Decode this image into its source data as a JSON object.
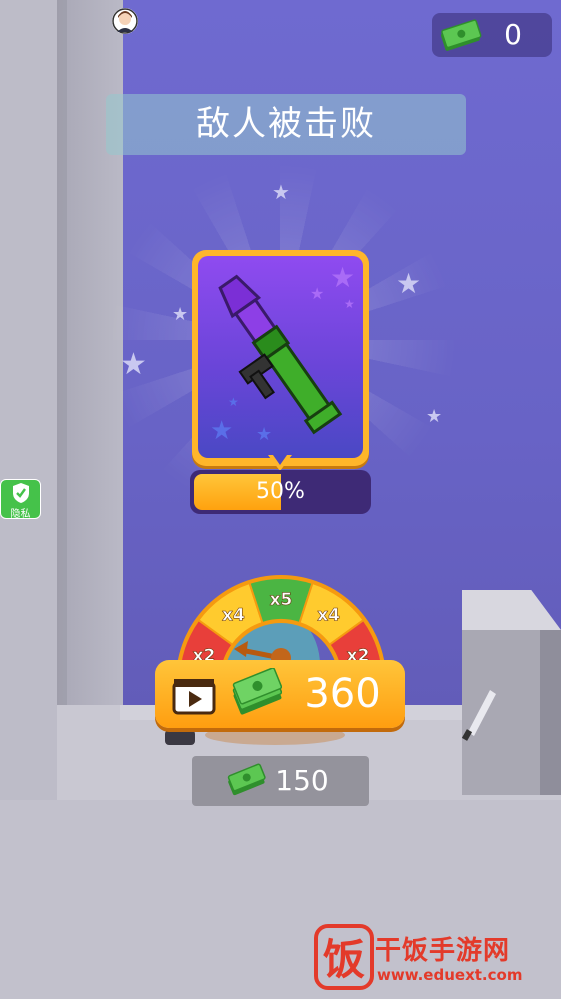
{
  "hud": {
    "money_count": "0",
    "cash_icon": "cash-stack-icon",
    "avatar_icon": "user-avatar-icon"
  },
  "title": {
    "text": "敌人被击败"
  },
  "reward_card": {
    "item_icon": "rocket-launcher-icon",
    "progress_fraction": 0.5,
    "progress_label": "50%"
  },
  "privacy": {
    "label": "隐私",
    "icon": "shield-check-icon"
  },
  "multiplier_wheel": {
    "segments": [
      "x2",
      "x4",
      "x5",
      "x4",
      "x2"
    ],
    "segment_colors": [
      "#e83f3a",
      "#ffcb2e",
      "#4bb543",
      "#ffcb2e",
      "#e83f3a"
    ]
  },
  "bonus_button": {
    "value": "360",
    "video_icon": "video-ad-icon"
  },
  "collect_button": {
    "value": "150"
  },
  "watermark": {
    "title": "干饭手游网",
    "url": "www.eduext.com",
    "logo_char": "饭"
  },
  "colors": {
    "accent_orange": "#ffa20e",
    "progress_track": "#3e2a76",
    "card_purple": "#8f4bf0",
    "cash_green": "#3fae3c"
  }
}
